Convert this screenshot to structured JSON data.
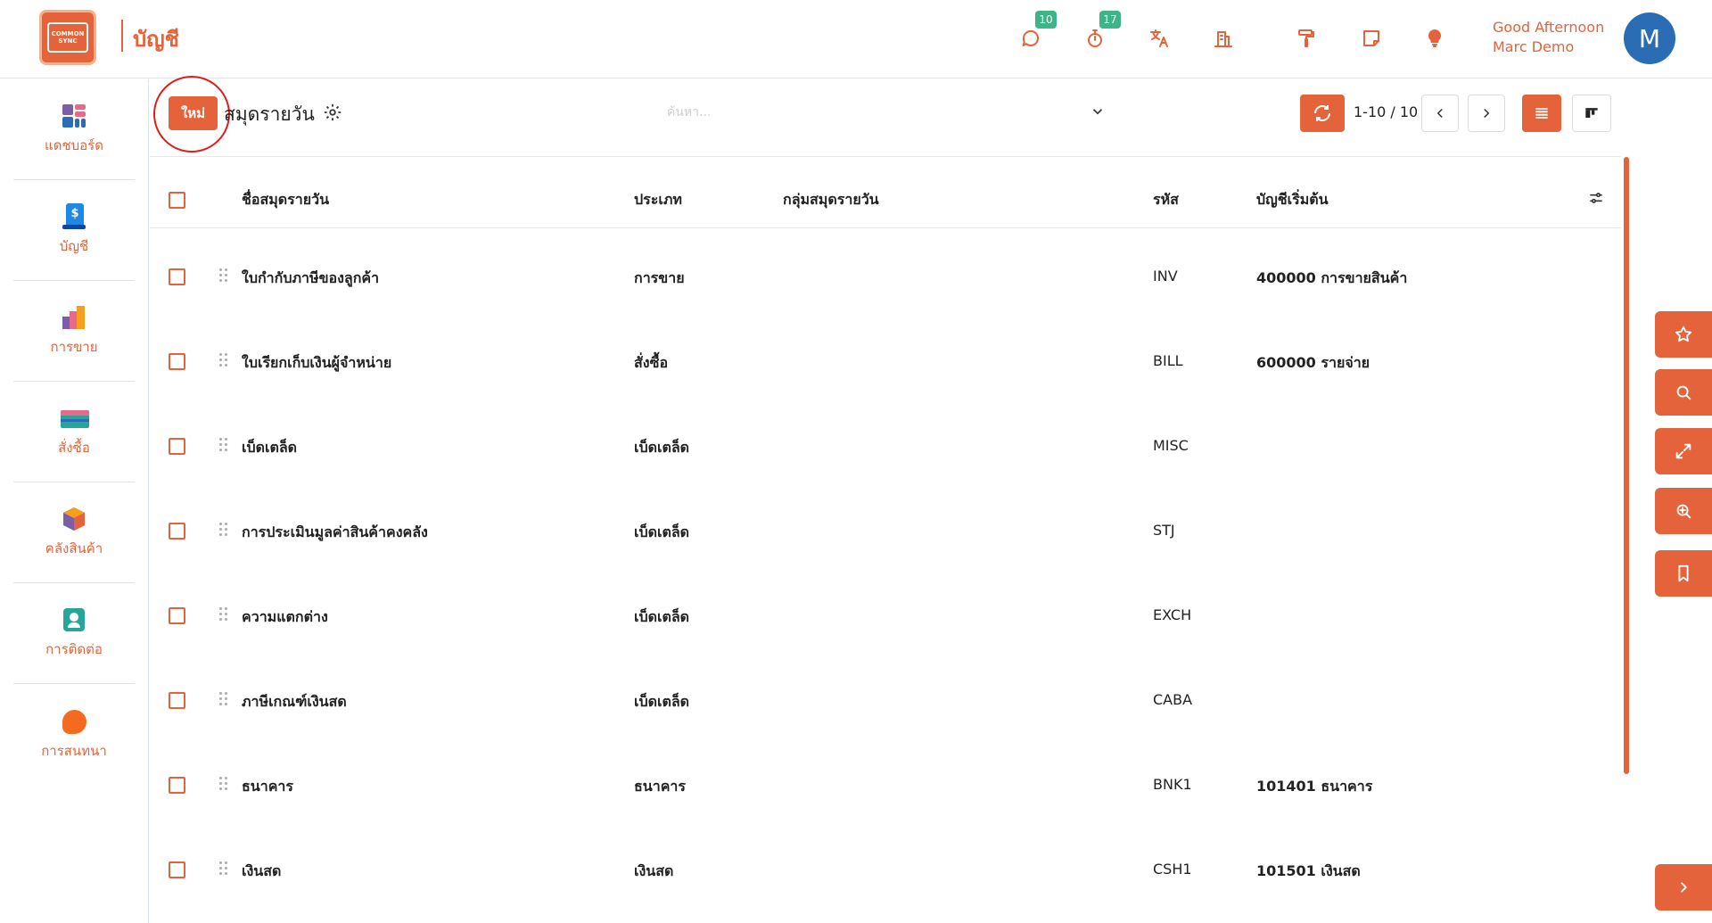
{
  "app": {
    "logo_text": "COMMON SYNC",
    "title": "บัญชี"
  },
  "topbar": {
    "messages_badge": "10",
    "activities_badge": "17",
    "greeting_line1": "Good Afternoon",
    "greeting_line2": "Marc Demo",
    "avatar_initial": "M"
  },
  "sidebar": {
    "items": [
      {
        "label": "แดชบอร์ด",
        "icon": "dashboard-icon"
      },
      {
        "label": "บัญชี",
        "icon": "accounting-icon"
      },
      {
        "label": "การขาย",
        "icon": "sales-icon"
      },
      {
        "label": "สั่งซื้อ",
        "icon": "purchase-icon"
      },
      {
        "label": "คลังสินค้า",
        "icon": "inventory-icon"
      },
      {
        "label": "การติดต่อ",
        "icon": "contacts-icon"
      },
      {
        "label": "การสนทนา",
        "icon": "discuss-icon"
      }
    ]
  },
  "control": {
    "new_label": "ใหม่",
    "page_title": "สมุดรายวัน",
    "search_placeholder": "ค้นหา...",
    "pager": "1-10 / 10"
  },
  "table": {
    "columns": [
      "ชื่อสมุดรายวัน",
      "ประเภท",
      "กลุ่มสมุดรายวัน",
      "รหัส",
      "บัญชีเริ่มต้น"
    ],
    "rows": [
      {
        "name": "ใบกำกับภาษีของลูกค้า",
        "type": "การขาย",
        "group": "",
        "code": "INV",
        "account": "400000 การขายสินค้า"
      },
      {
        "name": "ใบเรียกเก็บเงินผู้จำหน่าย",
        "type": "สั่งซื้อ",
        "group": "",
        "code": "BILL",
        "account": "600000 รายจ่าย"
      },
      {
        "name": "เบ็ดเตล็ด",
        "type": "เบ็ดเตล็ด",
        "group": "",
        "code": "MISC",
        "account": ""
      },
      {
        "name": "การประเมินมูลค่าสินค้าคงคลัง",
        "type": "เบ็ดเตล็ด",
        "group": "",
        "code": "STJ",
        "account": ""
      },
      {
        "name": "ความแตกต่าง",
        "type": "เบ็ดเตล็ด",
        "group": "",
        "code": "EXCH",
        "account": ""
      },
      {
        "name": "ภาษีเกณฑ์เงินสด",
        "type": "เบ็ดเตล็ด",
        "group": "",
        "code": "CABA",
        "account": ""
      },
      {
        "name": "ธนาคาร",
        "type": "ธนาคาร",
        "group": "",
        "code": "BNK1",
        "account": "101401 ธนาคาร"
      },
      {
        "name": "เงินสด",
        "type": "เงินสด",
        "group": "",
        "code": "CSH1",
        "account": "101501 เงินสด"
      }
    ]
  },
  "colors": {
    "accent": "#e4633a",
    "badge": "#3eb489",
    "avatar": "#2a6db5"
  }
}
